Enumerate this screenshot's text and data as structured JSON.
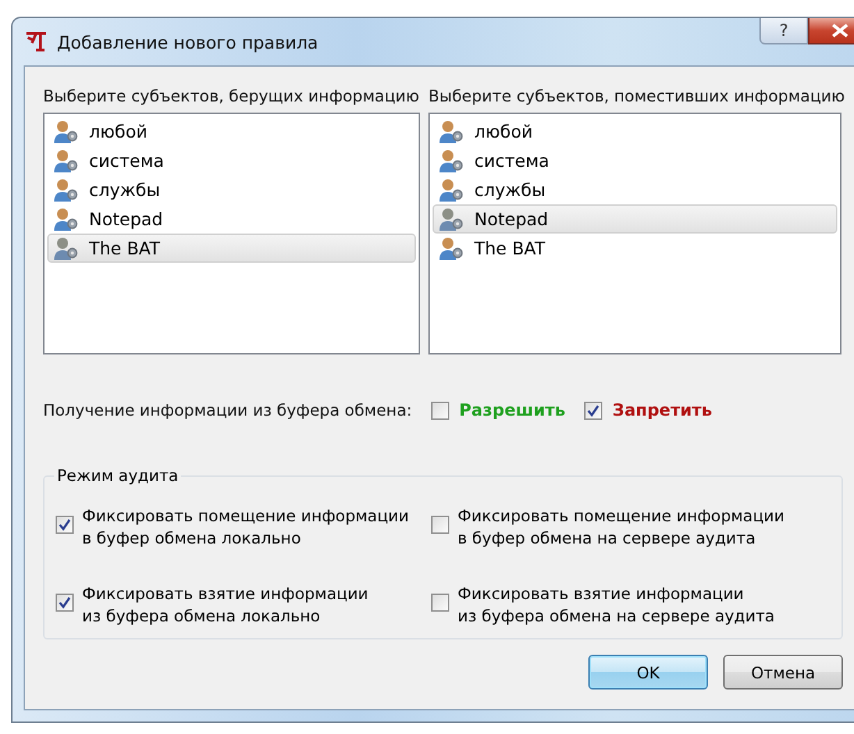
{
  "window": {
    "title": "Добавление нового правила",
    "help_button": "?"
  },
  "lists": [
    {
      "label": "Выберите субъектов, берущих информацию",
      "items": [
        {
          "name": "любой",
          "selected": false
        },
        {
          "name": "система",
          "selected": false
        },
        {
          "name": "службы",
          "selected": false
        },
        {
          "name": "Notepad",
          "selected": false
        },
        {
          "name": "The BAT",
          "selected": true
        }
      ]
    },
    {
      "label": "Выберите субъектов, поместивших информацию",
      "items": [
        {
          "name": "любой",
          "selected": false
        },
        {
          "name": "система",
          "selected": false
        },
        {
          "name": "службы",
          "selected": false
        },
        {
          "name": "Notepad",
          "selected": true
        },
        {
          "name": "The BAT",
          "selected": false
        }
      ]
    }
  ],
  "clipboard": {
    "label": "Получение информации из буфера обмена:",
    "options": [
      {
        "label": "Разрешить",
        "checked": false,
        "color": "#1ea01e"
      },
      {
        "label": "Запретить",
        "checked": true,
        "color": "#b01010"
      }
    ]
  },
  "audit": {
    "title": "Режим аудита",
    "options": [
      {
        "lines": [
          "Фиксировать помещение информации",
          "в буфер обмена локально"
        ],
        "checked": true
      },
      {
        "lines": [
          "Фиксировать помещение информации",
          "в буфер обмена на сервере аудита"
        ],
        "checked": false
      },
      {
        "lines": [
          "Фиксировать взятие информации",
          "из буфера обмена локально"
        ],
        "checked": true
      },
      {
        "lines": [
          "Фиксировать взятие информации",
          "из буфера обмена на сервере аудита"
        ],
        "checked": false
      }
    ]
  },
  "buttons": [
    {
      "label": "OK",
      "default": true
    },
    {
      "label": "Отмена",
      "default": false
    }
  ]
}
